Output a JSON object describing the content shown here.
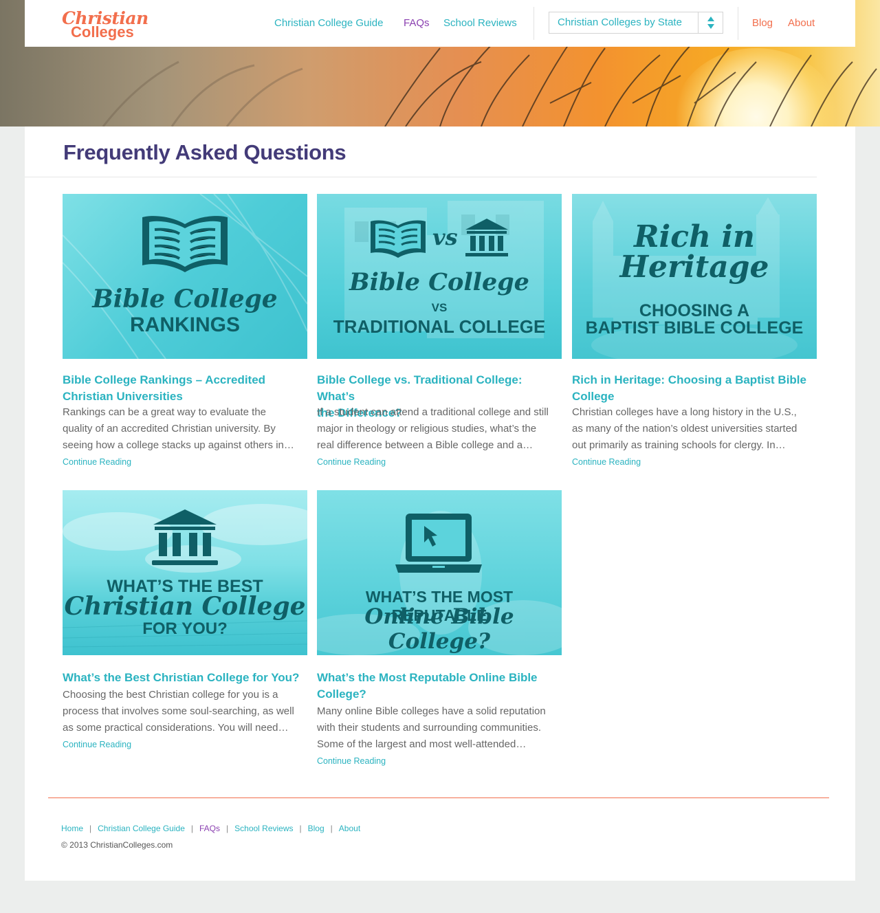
{
  "header": {
    "logo_line1": "Christian",
    "logo_line2": "Colleges",
    "nav": {
      "guide": "Christian College Guide",
      "faqs": "FAQs",
      "reviews": "School Reviews",
      "blog": "Blog",
      "about": "About"
    },
    "state_select": {
      "selected": "Christian Colleges by State"
    }
  },
  "page": {
    "title": "Frequently Asked Questions"
  },
  "articles": [
    {
      "image_text": {
        "line1": "Bible College",
        "line2": "RANKINGS"
      },
      "title_line1": "Bible College Rankings – Accredited",
      "title_line2": "Christian Universities",
      "excerpt_lines": [
        "Rankings can be a great way to evaluate the",
        "quality of an accredited Christian university. By",
        "seeing how a college stacks up against others in…"
      ],
      "more": "Continue Reading"
    },
    {
      "image_text": {
        "vs": "vs",
        "line1": "Bible College",
        "line2": "VS",
        "line3": "TRADITIONAL COLLEGE"
      },
      "title_line1": "Bible College vs. Traditional College: What’s",
      "title_line2": "the Difference?",
      "excerpt_lines": [
        "If a student can attend a traditional college and still",
        "major in theology or religious studies, what’s the",
        "real difference between a Bible college and a…"
      ],
      "more": "Continue Reading"
    },
    {
      "image_text": {
        "line1": "Rich in",
        "line2": "Heritage",
        "line3": "CHOOSING A",
        "line4": "BAPTIST BIBLE COLLEGE"
      },
      "title_line1": "Rich in Heritage: Choosing a Baptist Bible",
      "title_line2": "College",
      "excerpt_lines": [
        "Christian colleges have a long history in the U.S.,",
        "as many of the nation’s oldest universities started",
        "out primarily as training schools for clergy. In…"
      ],
      "more": "Continue Reading"
    },
    {
      "image_text": {
        "line1": "WHAT’S THE BEST",
        "line2": "Christian College",
        "line3": "FOR YOU?"
      },
      "title_line1": "What’s the Best Christian College for You?",
      "title_line2": "",
      "excerpt_lines": [
        "Choosing the best Christian college for you is a",
        "process that involves some soul-searching, as well",
        "as some practical considerations. You will need…"
      ],
      "more": "Continue Reading"
    },
    {
      "image_text": {
        "line1": "WHAT’S THE MOST REPUTABLE",
        "line2": "Online Bible College?"
      },
      "title_line1": "What’s the Most Reputable Online Bible",
      "title_line2": "College?",
      "excerpt_lines": [
        "Many online Bible colleges have a solid reputation",
        "with their students and surrounding communities.",
        "Some of the largest and most well-attended…"
      ],
      "more": "Continue Reading"
    }
  ],
  "footer": {
    "links": {
      "home": "Home",
      "guide": "Christian College Guide",
      "faqs": "FAQs",
      "reviews": "School Reviews",
      "blog": "Blog",
      "about": "About"
    },
    "copyright": "© 2013 ChristianColleges.com"
  },
  "colors": {
    "accent_teal": "#2bb3c0",
    "accent_orange": "#f26e4c",
    "accent_purple": "#8a3fb0",
    "title_indigo": "#433b78",
    "thumb_teal": "#5cd3dc",
    "thumb_dark": "#0f5f66"
  }
}
